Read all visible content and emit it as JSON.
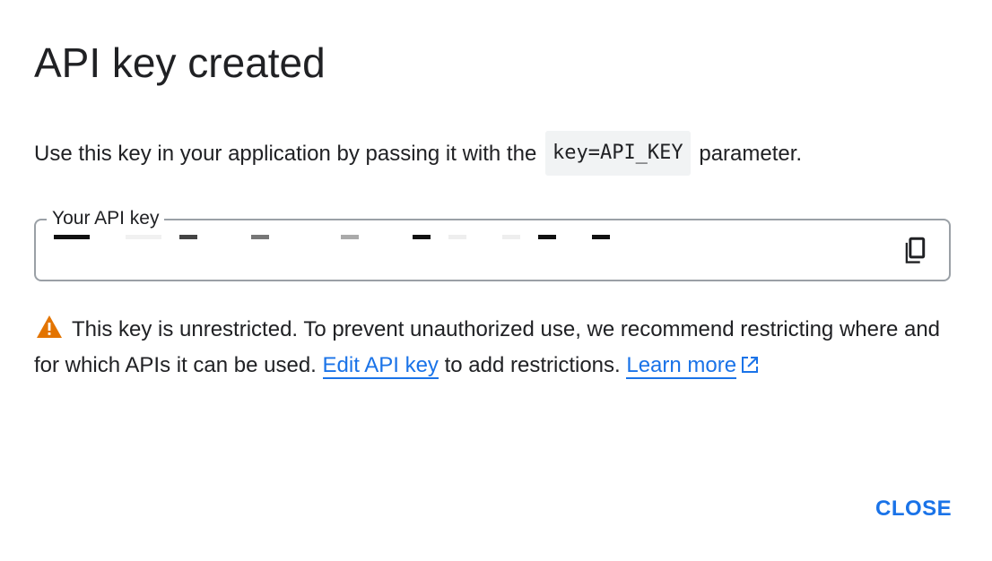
{
  "dialog": {
    "title": "API key created",
    "intro_before": "Use this key in your application by passing it with the",
    "intro_code": "key=API_KEY",
    "intro_after": "parameter.",
    "key_field": {
      "label": "Your API key",
      "value_redacted": true
    },
    "copy_icon": "copy-icon",
    "warning": {
      "icon": "warning-icon",
      "text_before": "This key is unrestricted. To prevent unauthorized use, we recommend restricting where and for which APIs it can be used.",
      "edit_link": "Edit API key",
      "text_middle": "to add restrictions.",
      "learn_link": "Learn more",
      "external_icon": "open-in-new-icon"
    },
    "close_label": "CLOSE"
  },
  "colors": {
    "accent": "#1a73e8",
    "warning": "#e37400",
    "text": "#202124",
    "border": "#9aa0a6"
  }
}
